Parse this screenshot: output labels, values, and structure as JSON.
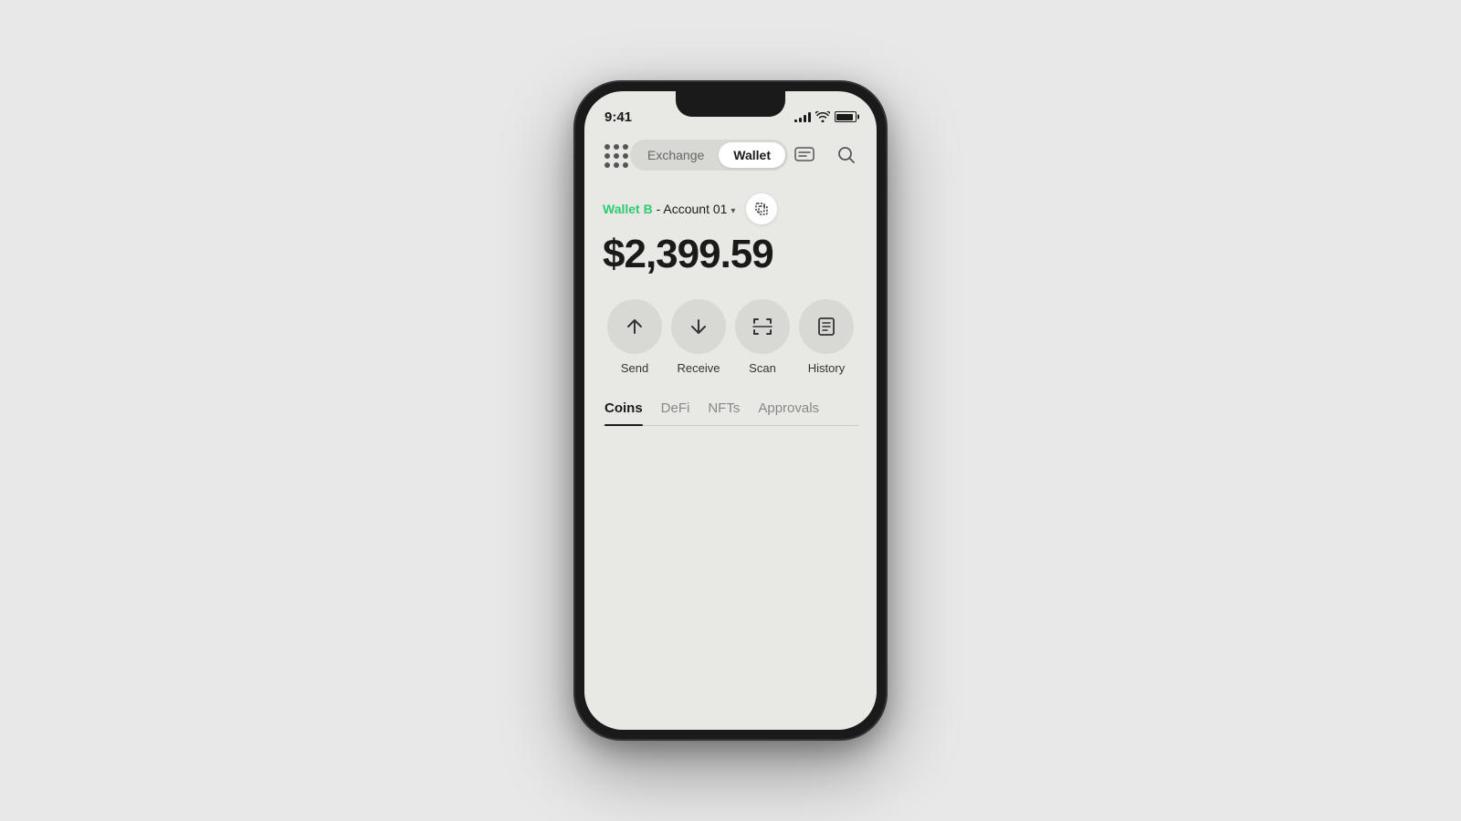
{
  "status": {
    "time": "9:41",
    "signal_bars": [
      3,
      5,
      8,
      11,
      13
    ],
    "battery_level": "full"
  },
  "header": {
    "exchange_tab": "Exchange",
    "wallet_tab": "Wallet",
    "active_tab": "wallet"
  },
  "account": {
    "wallet_name": "Wallet B",
    "account_name": "Account 01"
  },
  "balance": {
    "amount": "$2,399.59"
  },
  "actions": {
    "send": "Send",
    "receive": "Receive",
    "scan": "Scan",
    "history": "History"
  },
  "tabs": {
    "coins": "Coins",
    "defi": "DeFi",
    "nfts": "NFTs",
    "approvals": "Approvals",
    "active": "coins"
  }
}
